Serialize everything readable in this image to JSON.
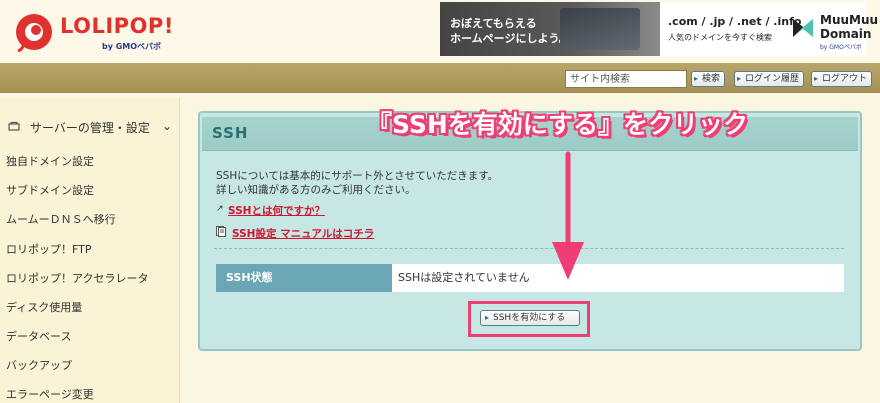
{
  "header": {
    "logo_text": "LOLIPOP!",
    "logo_sub": "by GMOペパボ",
    "banner_left_line1": "おぼえてもらえる",
    "banner_left_line2": "ホームページにしよう。",
    "banner_right_domains": ".com / .jp / .net / .info",
    "banner_right_sub": "人気のドメインを今すぐ検索",
    "banner_brand_line1": "MuuMuu",
    "banner_brand_line2": "Domain",
    "banner_brand_sub": "by GMOペパボ"
  },
  "toolbar": {
    "search_placeholder": "サイト内検索",
    "search_button": "検索",
    "login_history_button": "ログイン履歴",
    "logout_button": "ログアウト"
  },
  "sidebar": {
    "section_title": "サーバーの管理・設定",
    "items": [
      "独自ドメイン設定",
      "サブドメイン設定",
      "ムームーＤＮＳへ移行",
      "ロリポップ！FTP",
      "ロリポップ！アクセラレータ",
      "ディスク使用量",
      "データベース",
      "バックアップ",
      "エラーページ変更"
    ]
  },
  "panel": {
    "title": "SSH",
    "desc_line1": "SSHについては基本的にサポート外とさせていただきます。",
    "desc_line2": "詳しい知識がある方のみご利用ください。",
    "link_what": "SSHとは何ですか？",
    "link_manual": "SSH設定 マニュアルはコチラ",
    "status_label": "SSH状態",
    "status_value": "SSHは設定されていません",
    "enable_button": "SSHを有効にする"
  },
  "annotation": {
    "text": "『SSHを有効にする』をクリック"
  },
  "colors": {
    "accent_pink": "#ef3e74",
    "link_red": "#d2142f",
    "panel_teal": "#c6e7e3",
    "status_label_bg": "#6aa6b6",
    "toolbar_olive": "#a49052"
  }
}
